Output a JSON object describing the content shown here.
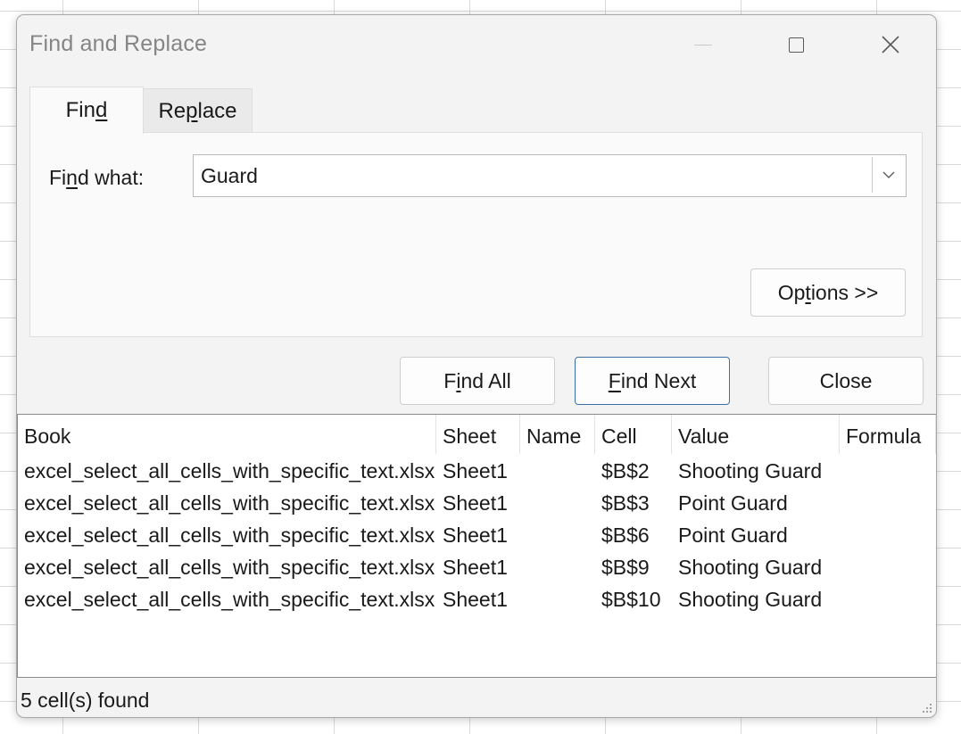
{
  "window": {
    "title": "Find and Replace"
  },
  "tabs": {
    "find": {
      "pre": "Fin",
      "key": "d",
      "post": ""
    },
    "replace": {
      "pre": "Re",
      "key": "p",
      "post": "lace"
    }
  },
  "find": {
    "label": {
      "pre": "Fi",
      "key": "n",
      "post": "d what:"
    },
    "value": "Guard"
  },
  "buttons": {
    "options": {
      "pre": "Op",
      "key": "t",
      "post": "ions >>"
    },
    "find_all": {
      "pre": "F",
      "key": "i",
      "post": "nd All"
    },
    "find_next": {
      "pre": "",
      "key": "F",
      "post": "ind Next"
    },
    "close": "Close"
  },
  "results": {
    "columns": [
      "Book",
      "Sheet",
      "Name",
      "Cell",
      "Value",
      "Formula"
    ],
    "rows": [
      {
        "book": "excel_select_all_cells_with_specific_text.xlsx",
        "sheet": "Sheet1",
        "name": "",
        "cell": "$B$2",
        "value": "Shooting Guard",
        "formula": ""
      },
      {
        "book": "excel_select_all_cells_with_specific_text.xlsx",
        "sheet": "Sheet1",
        "name": "",
        "cell": "$B$3",
        "value": "Point Guard",
        "formula": ""
      },
      {
        "book": "excel_select_all_cells_with_specific_text.xlsx",
        "sheet": "Sheet1",
        "name": "",
        "cell": "$B$6",
        "value": "Point Guard",
        "formula": ""
      },
      {
        "book": "excel_select_all_cells_with_specific_text.xlsx",
        "sheet": "Sheet1",
        "name": "",
        "cell": "$B$9",
        "value": "Shooting Guard",
        "formula": ""
      },
      {
        "book": "excel_select_all_cells_with_specific_text.xlsx",
        "sheet": "Sheet1",
        "name": "",
        "cell": "$B$10",
        "value": "Shooting Guard",
        "formula": ""
      }
    ]
  },
  "status": "5 cell(s) found",
  "icons": {
    "minimize": "minimize-icon",
    "maximize": "maximize-icon",
    "close": "close-icon",
    "dropdown": "chevron-down-icon",
    "resize": "resize-grip-icon"
  }
}
